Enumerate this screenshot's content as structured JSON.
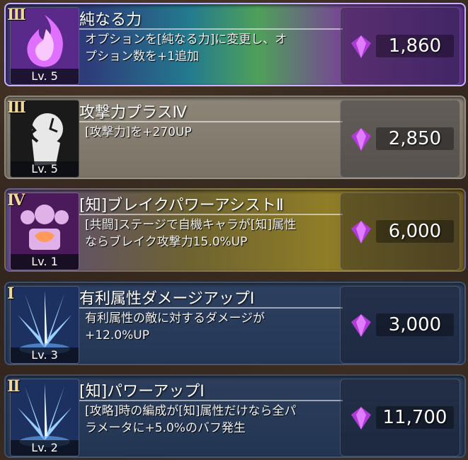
{
  "items": [
    {
      "tier": "III",
      "level": "Lv. 5",
      "title": "純なる力",
      "desc": [
        "オプションを[純なる力]に変更し、オ",
        "プション数を+1追加"
      ],
      "price": "1,860",
      "icon": "pink-flame-icon"
    },
    {
      "tier": "III",
      "level": "Lv. 5",
      "title": "攻撃力プラスⅣ",
      "desc": [
        "[攻撃力]を+270UP",
        ""
      ],
      "price": "2,850",
      "icon": "broken-fist-icon"
    },
    {
      "tier": "IV",
      "level": "Lv. 1",
      "title": "[知]ブレイクパワーアシストⅡ",
      "desc": [
        "[共闘]ステージで自機キャラが[知]属性",
        "ならブレイク攻撃力15.0%UP"
      ],
      "price": "6,000",
      "icon": "power-assist-icon"
    },
    {
      "tier": "I",
      "level": "Lv. 3",
      "title": "有利属性ダメージアップⅠ",
      "desc": [
        "有利属性の敵に対するダメージが",
        "+12.0%UP"
      ],
      "price": "3,000",
      "icon": "ice-burst-icon"
    },
    {
      "tier": "II",
      "level": "Lv. 2",
      "title": "[知]パワーアップⅠ",
      "desc": [
        "[攻略]時の編成が[知]属性だけなら全パ",
        "ラメータに+5.0%のバフ発生"
      ],
      "price": "11,700",
      "icon": "ice-burst-icon"
    }
  ],
  "colors": {
    "gem": "#c040e0",
    "tier": "#f0d89a"
  }
}
